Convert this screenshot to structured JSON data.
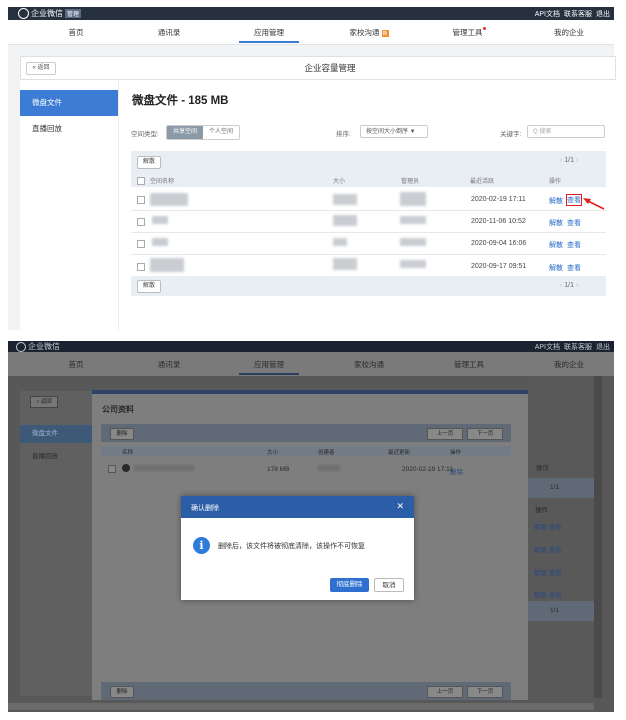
{
  "top": {
    "brand": "企业微信",
    "brand_badge": "管理",
    "links": [
      "API文档",
      "联系客服",
      "退出"
    ],
    "nav": [
      "首页",
      "通讯录",
      "应用管理",
      "家校沟通",
      "管理工具",
      "我的企业"
    ],
    "nav_tag": "新",
    "back": "« 返回",
    "page_title": "企业容量管理",
    "sidebar": [
      "微盘文件",
      "直播回放"
    ],
    "heading": "微盘文件 - 185 MB",
    "space_type_label": "空间类型:",
    "space_tabs": [
      "共享空间",
      "个人空间"
    ],
    "sort_label": "排序:",
    "sort_value": "按空间大小倒序 ▼",
    "keyword_label": "关键字:",
    "search_placeholder": "Q  搜索",
    "dissolve": "解散",
    "pager": "1/1",
    "columns": [
      "空间名称",
      "大小",
      "管理员",
      "最近活跃",
      "操作"
    ],
    "rows": [
      {
        "date": "2020-02-19 17:11",
        "op1": "解散",
        "op2": "查看"
      },
      {
        "date": "2020-11-06 10:52",
        "op1": "解散",
        "op2": "查看"
      },
      {
        "date": "2020-09-04 16:06",
        "op1": "解散",
        "op2": "查看"
      },
      {
        "date": "2020-09-17 09:51",
        "op1": "解散",
        "op2": "查看"
      }
    ]
  },
  "bottom": {
    "brand": "企业微信",
    "links": [
      "API文档",
      "联系客服",
      "退出"
    ],
    "nav": [
      "首页",
      "通讯录",
      "应用管理",
      "家校沟通",
      "管理工具",
      "我的企业"
    ],
    "back": "« 返回",
    "sidebar": [
      "微盘文件",
      "直播回放"
    ],
    "modal_title": "公司资料",
    "delete": "删除",
    "prev": "上一页",
    "next": "下一页",
    "columns": [
      "名称",
      "大小",
      "创建者",
      "最近更新",
      "操作"
    ],
    "file_size": "178 MB",
    "file_date": "2020-02-19 17:11",
    "file_op": "删除",
    "right_col_header": "操作",
    "right_pager": "1/1",
    "right_ops": [
      "解散 查看",
      "解散 查看",
      "解散 查看",
      "解散 查看"
    ],
    "dialog_title": "确认删除",
    "dialog_close": "✕",
    "dialog_message": "删除后，该文件将被彻底清除，该操作不可恢复",
    "confirm": "彻底删除",
    "cancel": "取消"
  },
  "colors": {
    "accent": "#3d7cd5",
    "topbar": "#26303f",
    "highlight": "#e02020",
    "dialog_head": "#2b5ea7"
  }
}
